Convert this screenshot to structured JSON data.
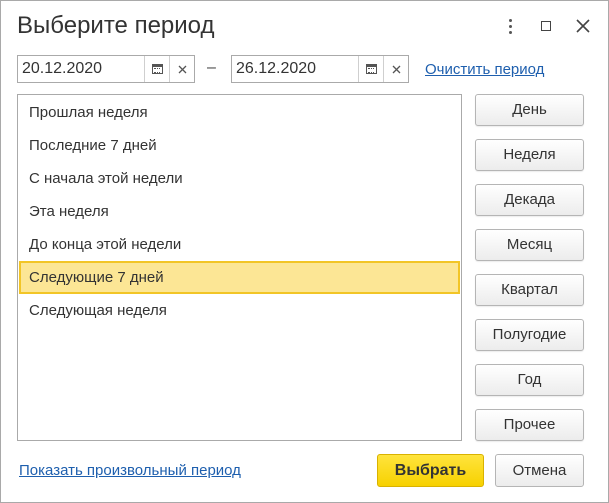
{
  "window": {
    "title": "Выберите период",
    "icons": {
      "more": "more-vertical-icon",
      "maximize": "maximize-icon",
      "close": "close-icon"
    }
  },
  "period": {
    "start_value": "20.12.2020",
    "end_value": "26.12.2020",
    "separator": "–",
    "clear_link": "Очистить период"
  },
  "presets": {
    "items": [
      {
        "label": "Прошлая неделя",
        "selected": false
      },
      {
        "label": "Последние 7 дней",
        "selected": false
      },
      {
        "label": "С начала этой недели",
        "selected": false
      },
      {
        "label": "Эта неделя",
        "selected": false
      },
      {
        "label": "До конца этой недели",
        "selected": false
      },
      {
        "label": "Следующие 7 дней",
        "selected": true
      },
      {
        "label": "Следующая неделя",
        "selected": false
      }
    ]
  },
  "period_buttons": [
    "День",
    "Неделя",
    "Декада",
    "Месяц",
    "Квартал",
    "Полугодие",
    "Год",
    "Прочее"
  ],
  "footer": {
    "custom_link": "Показать произвольный период",
    "select_label": "Выбрать",
    "cancel_label": "Отмена"
  },
  "colors": {
    "selection_fill": "#fce695",
    "selection_border": "#f2c526",
    "primary_button": "#f7d100",
    "link": "#1e5fae"
  }
}
